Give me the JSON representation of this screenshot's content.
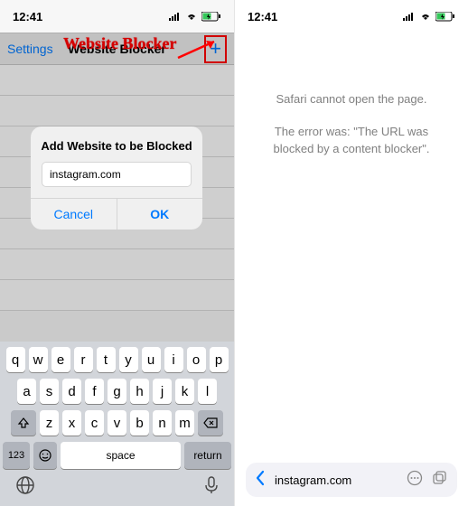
{
  "left": {
    "status": {
      "time": "12:41"
    },
    "nav": {
      "settings": "Settings",
      "title": "Website Blocker",
      "plus": "+"
    },
    "annotation": "Website Blocker",
    "alert": {
      "title": "Add Website to be Blocked",
      "input_value": "instagram.com",
      "cancel": "Cancel",
      "ok": "OK"
    },
    "keyboard": {
      "row1": [
        "q",
        "w",
        "e",
        "r",
        "t",
        "y",
        "u",
        "i",
        "o",
        "p"
      ],
      "row2": [
        "a",
        "s",
        "d",
        "f",
        "g",
        "h",
        "j",
        "k",
        "l"
      ],
      "row3": [
        "z",
        "x",
        "c",
        "v",
        "b",
        "n",
        "m"
      ],
      "space": "space",
      "return": "return",
      "num": "123"
    }
  },
  "right": {
    "status": {
      "time": "12:41"
    },
    "error1": "Safari cannot open the page.",
    "error2": "The error was: \"The URL was blocked by a content blocker\".",
    "url": "instagram.com"
  }
}
